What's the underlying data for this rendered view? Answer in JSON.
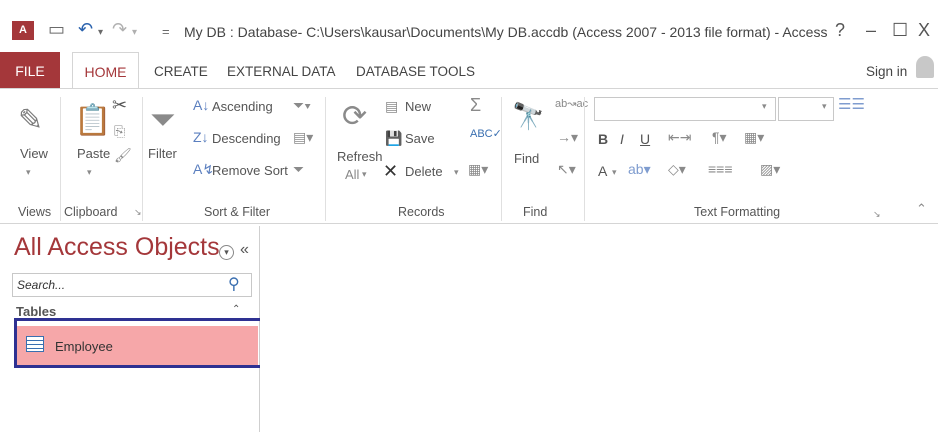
{
  "window": {
    "title": "My DB : Database- C:\\Users\\kausar\\Documents\\My DB.accdb (Access 2007 - 2013 file format) - Access",
    "app_icon": "A",
    "help": "?",
    "minimize": "–",
    "maximize": "☐",
    "close": "X",
    "sign_in": "Sign in",
    "qat_dropdown": "="
  },
  "tabs": {
    "file": "FILE",
    "home": "HOME",
    "create": "CREATE",
    "external": "EXTERNAL DATA",
    "dbtools": "DATABASE TOOLS"
  },
  "ribbon": {
    "views": {
      "view": "View",
      "group": "Views"
    },
    "clipboard": {
      "paste": "Paste",
      "group": "Clipboard"
    },
    "sort_filter": {
      "filter": "Filter",
      "ascending": "Ascending",
      "descending": "Descending",
      "remove_sort": "Remove Sort",
      "group": "Sort & Filter"
    },
    "records": {
      "new": "New",
      "save": "Save",
      "refresh": "Refresh",
      "refresh_all": "All",
      "delete": "Delete",
      "group": "Records"
    },
    "find": {
      "find": "Find",
      "group": "Find"
    },
    "text_formatting": {
      "bold": "B",
      "italic": "I",
      "underline": "U",
      "font_color": "A",
      "group": "Text Formatting"
    }
  },
  "nav_pane": {
    "title": "All Access Objects",
    "collapse": "«",
    "search_placeholder": "Search...",
    "section": "Tables",
    "items": [
      {
        "label": "Employee"
      }
    ]
  },
  "colors": {
    "accent": "#a4373a",
    "selected_row": "#f6a7a9",
    "highlight_box": "#2e3192"
  }
}
